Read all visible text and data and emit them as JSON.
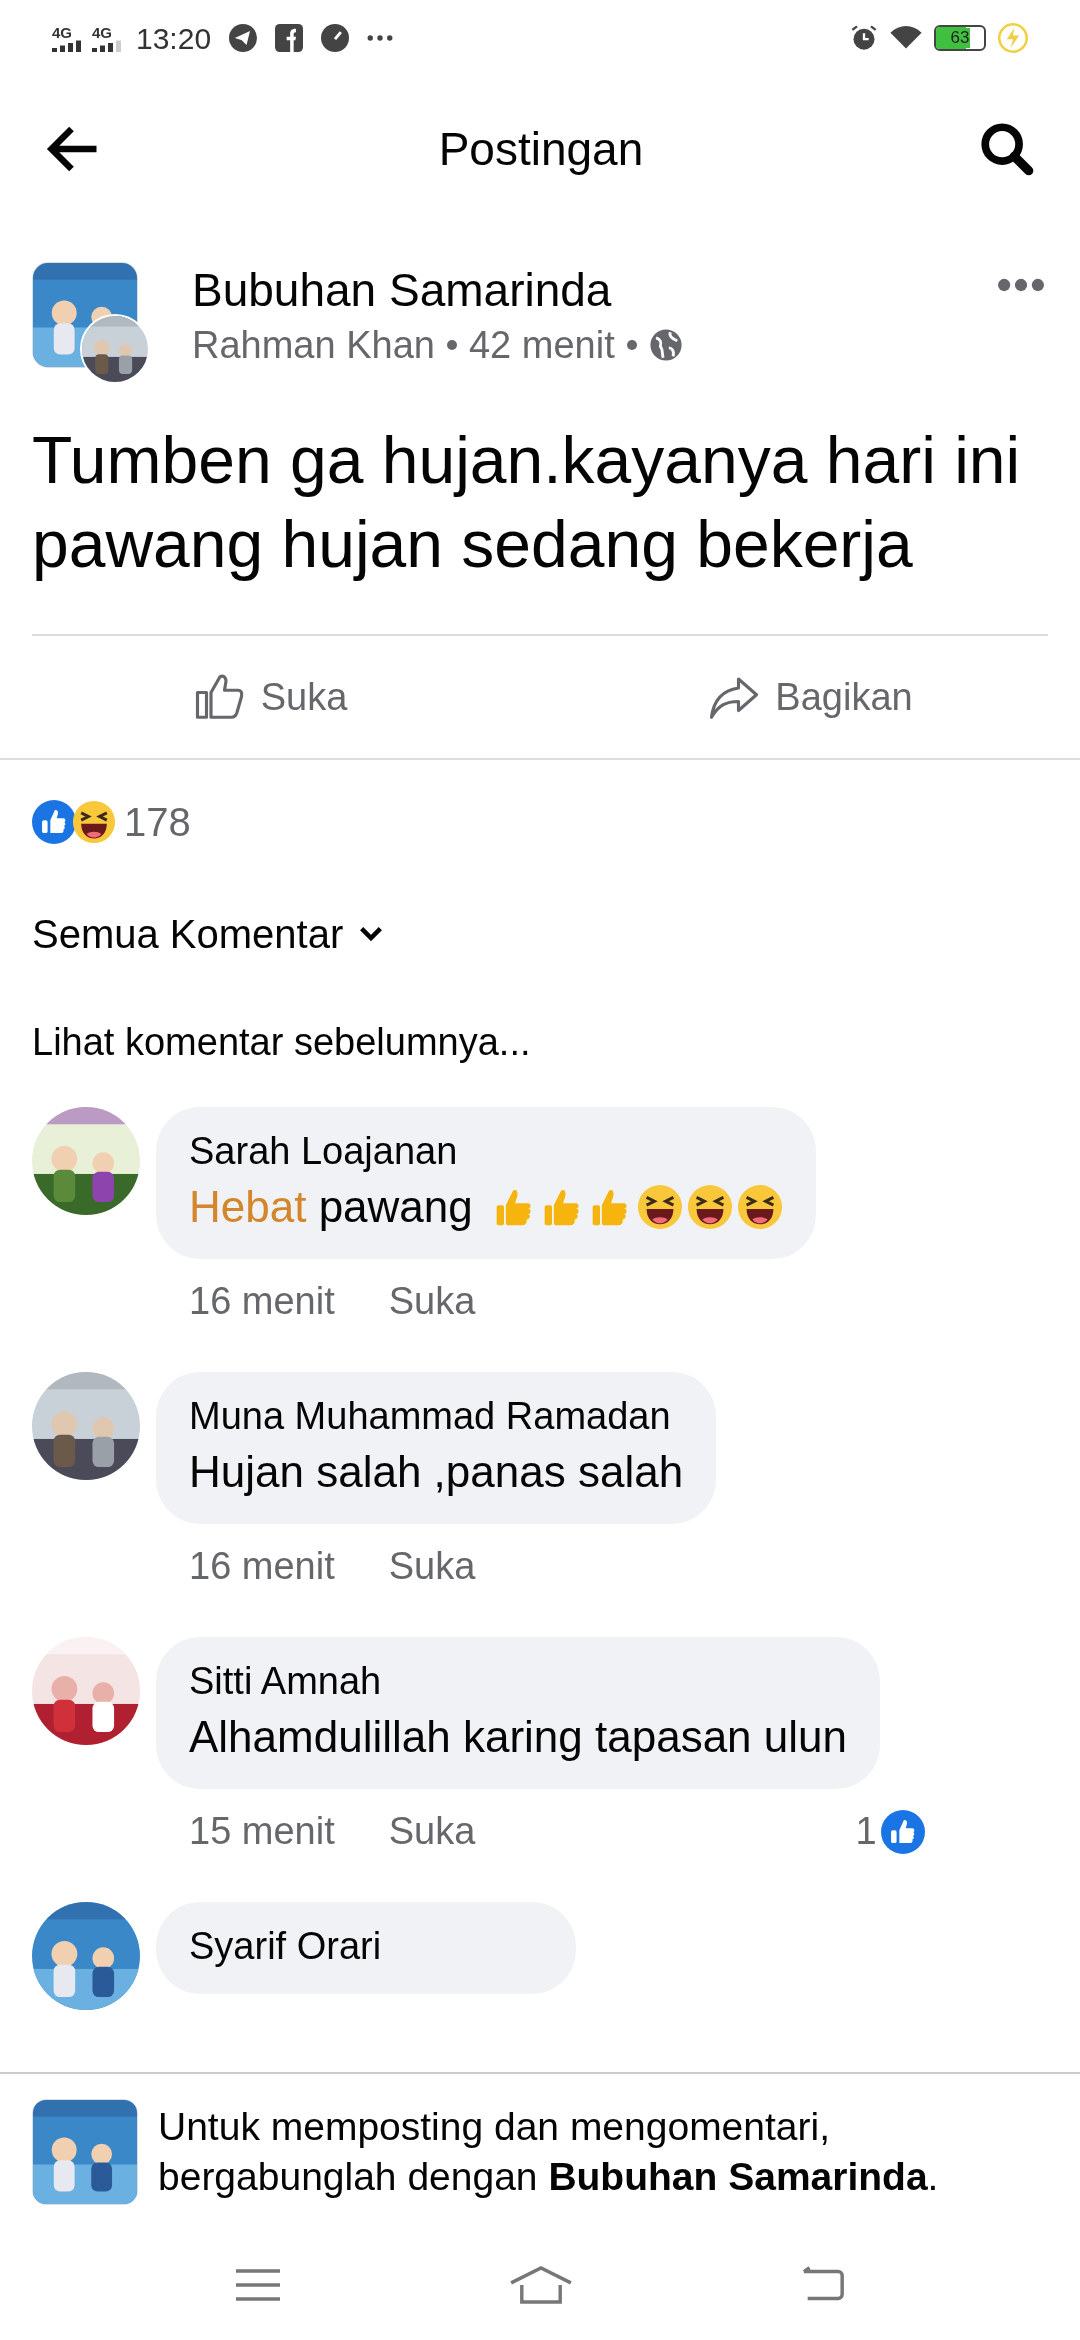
{
  "status_bar": {
    "time": "13:20",
    "battery": "63",
    "signals": [
      "4G",
      "4G"
    ]
  },
  "header": {
    "title": "Postingan"
  },
  "post": {
    "group": "Bubuhan Samarinda",
    "author": "Rahman Khan",
    "time": "42 menit",
    "text": "Tumben ga hujan.kayanya hari ini pawang hujan sedang bekerja"
  },
  "actions": [
    {
      "kind": "like",
      "label": "Suka"
    },
    {
      "kind": "share",
      "label": "Bagikan"
    }
  ],
  "reactions": {
    "count": "178"
  },
  "filter": {
    "label": "Semua Komentar"
  },
  "previous_link": "Lihat komentar sebelumnya...",
  "comments": [
    {
      "name": "Sarah Loajanan",
      "parts": [
        {
          "text": "Hebat",
          "highlight": true
        },
        {
          "text": " pawang",
          "highlight": false
        }
      ],
      "emojis": [
        {
          "kind": "thumbs"
        },
        {
          "kind": "thumbs"
        },
        {
          "kind": "thumbs"
        },
        {
          "kind": "laugh"
        },
        {
          "kind": "laugh"
        },
        {
          "kind": "laugh"
        }
      ],
      "time": "16 menit",
      "like": "Suka"
    },
    {
      "name": "Muna Muhammad Ramadan",
      "parts": [
        {
          "text": "Hujan salah ,panas salah",
          "highlight": false
        }
      ],
      "time": "16 menit",
      "like": "Suka"
    },
    {
      "name": "Sitti Amnah",
      "parts": [
        {
          "text": "Alhamdulillah karing tapasan ulun",
          "highlight": false
        }
      ],
      "time": "15 menit",
      "like": "Suka",
      "likes": "1"
    },
    {
      "name": "Syarif Orari"
    }
  ],
  "join_bar": {
    "text": "Untuk memposting dan mengomentari, bergabunglah dengan **Bubuhan Samarinda**."
  }
}
